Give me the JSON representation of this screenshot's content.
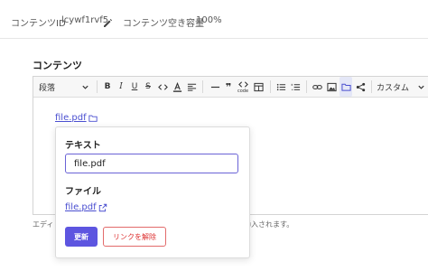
{
  "header": {
    "content_id_label": "コンテンツID",
    "content_id_value": "lcywf1rvf5",
    "capacity_label": "コンテンツ空き容量",
    "capacity_value": "100%"
  },
  "section": {
    "title": "コンテンツ"
  },
  "toolbar": {
    "paragraph_select": "段落",
    "custom_select": "カスタム",
    "code_block_label": "code"
  },
  "editor_content": {
    "link_text": "file.pdf"
  },
  "footnote": {
    "left": "エディ",
    "right": "挿入されます。"
  },
  "link_popup": {
    "text_label": "テキスト",
    "text_value": "file.pdf",
    "file_label": "ファイル",
    "file_link": "file.pdf",
    "update_button": "更新",
    "unlink_button": "リンクを解除"
  },
  "colors": {
    "accent": "#5d55e0",
    "link": "#4a4fd0",
    "danger": "#dd3333"
  }
}
